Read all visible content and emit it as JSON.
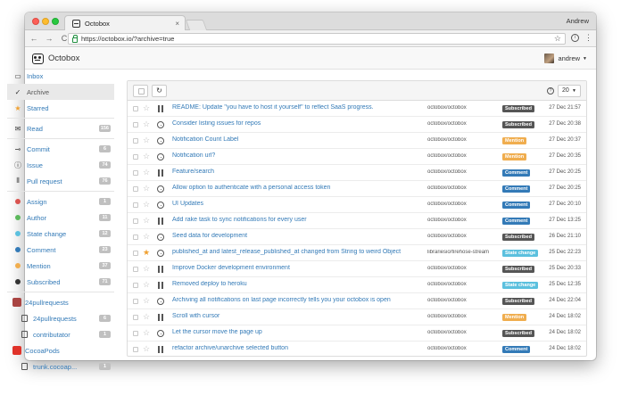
{
  "browser": {
    "tab_title": "Octobox",
    "tab_close": "×",
    "profile": "Andrew",
    "url": "https://octobox.io/?archive=true",
    "back": "←",
    "forward": "→",
    "reload": "C",
    "bookmark_star": "☆",
    "info": "i",
    "menu": "⋮"
  },
  "app": {
    "brand": "Octobox",
    "user": "andrew"
  },
  "sidebar": {
    "primary": [
      {
        "label": "Inbox",
        "icon": "inbox-icon",
        "glyph": "▭"
      },
      {
        "label": "Archive",
        "icon": "check-icon",
        "glyph": "✓",
        "active": true
      },
      {
        "label": "Starred",
        "icon": "star-icon",
        "glyph": "★"
      }
    ],
    "read": {
      "label": "Read",
      "badge": "156",
      "glyph": "✉"
    },
    "types": [
      {
        "label": "Commit",
        "badge": "6",
        "glyph": "⊸"
      },
      {
        "label": "Issue",
        "badge": "74",
        "glyph": "ⓘ"
      },
      {
        "label": "Pull request",
        "badge": "76",
        "glyph": "⫴"
      }
    ],
    "reasons": [
      {
        "label": "Assign",
        "badge": "1",
        "color": "#d9534f"
      },
      {
        "label": "Author",
        "badge": "11",
        "color": "#5cb85c"
      },
      {
        "label": "State change",
        "badge": "12",
        "color": "#5bc0de"
      },
      {
        "label": "Comment",
        "badge": "23",
        "color": "#337ab7"
      },
      {
        "label": "Mention",
        "badge": "37",
        "color": "#f0ad4e"
      },
      {
        "label": "Subscribed",
        "badge": "71",
        "color": "#333333"
      }
    ],
    "orgs": [
      {
        "name": "24pullrequests",
        "color": "#a94442",
        "repos": [
          {
            "label": "24pullrequests",
            "badge": "6"
          },
          {
            "label": "contributator",
            "badge": "1"
          }
        ]
      },
      {
        "name": "CocoaPods",
        "color": "#e0332a",
        "repos": [
          {
            "label": "trunk.cocoap...",
            "badge": "1"
          }
        ]
      }
    ]
  },
  "panel": {
    "per_page": "20",
    "help": "?",
    "refresh": "↻"
  },
  "colors": {
    "Subscribed": "#555555",
    "Mention": "#f0ad4e",
    "Comment": "#337ab7",
    "State change": "#5bc0de"
  },
  "notifications": [
    {
      "type": "pr",
      "starred": false,
      "title": "README: Update \"you have to host it yourself\" to reflect SaaS progress.",
      "repo": "octobox/octobox",
      "reason": "Subscribed",
      "date": "27 Dec 21:57"
    },
    {
      "type": "issue",
      "starred": false,
      "title": "Consider listing issues for repos",
      "repo": "octobox/octobox",
      "reason": "Subscribed",
      "date": "27 Dec 20:38"
    },
    {
      "type": "issue",
      "starred": false,
      "title": "Notification Count Label",
      "repo": "octobox/octobox",
      "reason": "Mention",
      "date": "27 Dec 20:37"
    },
    {
      "type": "issue",
      "starred": false,
      "title": "Notification url?",
      "repo": "octobox/octobox",
      "reason": "Mention",
      "date": "27 Dec 20:35"
    },
    {
      "type": "pr",
      "starred": false,
      "title": "Feature/search",
      "repo": "octobox/octobox",
      "reason": "Comment",
      "date": "27 Dec 20:25"
    },
    {
      "type": "issue",
      "starred": false,
      "title": "Allow option to authenticate with a personal access token",
      "repo": "octobox/octobox",
      "reason": "Comment",
      "date": "27 Dec 20:25"
    },
    {
      "type": "issue",
      "starred": false,
      "title": "UI Updates",
      "repo": "octobox/octobox",
      "reason": "Comment",
      "date": "27 Dec 20:10"
    },
    {
      "type": "pr",
      "starred": false,
      "title": "Add rake task to sync notifications for every user",
      "repo": "octobox/octobox",
      "reason": "Comment",
      "date": "27 Dec 13:25"
    },
    {
      "type": "issue",
      "starred": false,
      "title": "Seed data for development",
      "repo": "octobox/octobox",
      "reason": "Subscribed",
      "date": "26 Dec 21:10"
    },
    {
      "type": "issue",
      "starred": true,
      "title": "published_at and latest_release_published_at changed from String to weird Object",
      "repo": "librariesio/firehose-stream",
      "reason": "State change",
      "date": "25 Dec 22:23"
    },
    {
      "type": "pr",
      "starred": false,
      "title": "Improve Docker development environment",
      "repo": "octobox/octobox",
      "reason": "Subscribed",
      "date": "25 Dec 20:33"
    },
    {
      "type": "pr",
      "starred": false,
      "title": "Removed deploy to heroku",
      "repo": "octobox/octobox",
      "reason": "State change",
      "date": "25 Dec 12:35"
    },
    {
      "type": "issue",
      "starred": false,
      "title": "Archiving all notifications on last page incorrectly tells you your octobox is open",
      "repo": "octobox/octobox",
      "reason": "Subscribed",
      "date": "24 Dec 22:04"
    },
    {
      "type": "pr",
      "starred": false,
      "title": "Scroll with cursor",
      "repo": "octobox/octobox",
      "reason": "Mention",
      "date": "24 Dec 18:02"
    },
    {
      "type": "issue",
      "starred": false,
      "title": "Let the cursor move the page up",
      "repo": "octobox/octobox",
      "reason": "Subscribed",
      "date": "24 Dec 18:02"
    },
    {
      "type": "pr",
      "starred": false,
      "title": "refactor archive/unarchive selected button",
      "repo": "octobox/octobox",
      "reason": "Comment",
      "date": "24 Dec 18:02"
    }
  ]
}
